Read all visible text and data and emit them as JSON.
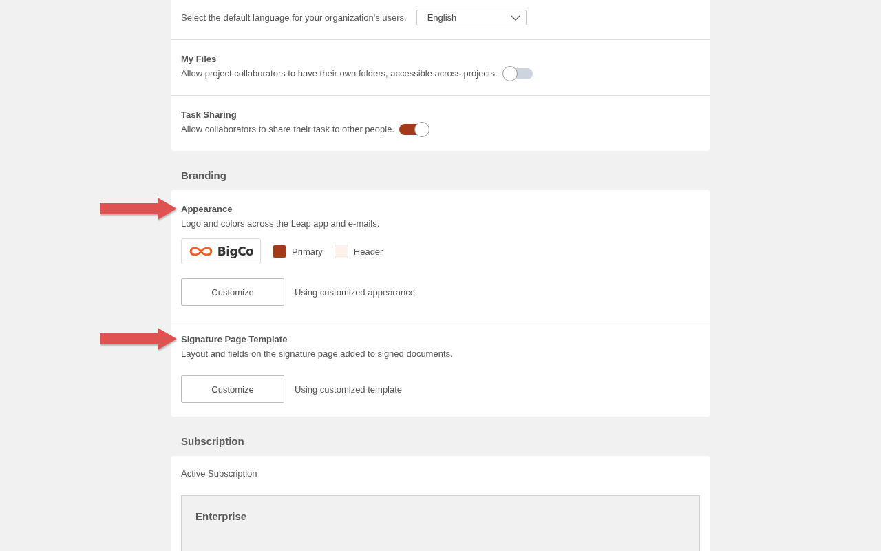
{
  "sections": [
    {
      "items": [
        {
          "kind": "select",
          "description": "Select the default language for your organization's users.",
          "value": "English"
        },
        {
          "kind": "toggle",
          "title": "My Files",
          "description": "Allow project collaborators to have their own folders, accessible across projects.",
          "on": false
        },
        {
          "kind": "toggle",
          "title": "Task Sharing",
          "description": "Allow collaborators to share their task to other people.",
          "on": true
        }
      ]
    },
    {
      "heading": "Branding",
      "items": [
        {
          "kind": "customize",
          "title": "Appearance",
          "description": "Logo and colors across the Leap app and e-mails.",
          "arrow": true,
          "logo_text": "BigCo",
          "swatches": [
            {
              "label": "Primary",
              "color": "#a33b1a"
            },
            {
              "label": "Header",
              "color": "#fdf1ec"
            }
          ],
          "button": "Customize",
          "status": "Using customized appearance"
        },
        {
          "kind": "customize",
          "title": "Signature Page Template",
          "description": "Layout and fields on the signature page added to signed documents.",
          "arrow": true,
          "button": "Customize",
          "status": "Using customized template"
        }
      ]
    },
    {
      "heading": "Subscription",
      "items": [
        {
          "kind": "subscription",
          "label": "Active Subscription",
          "plan": "Enterprise"
        }
      ]
    }
  ]
}
